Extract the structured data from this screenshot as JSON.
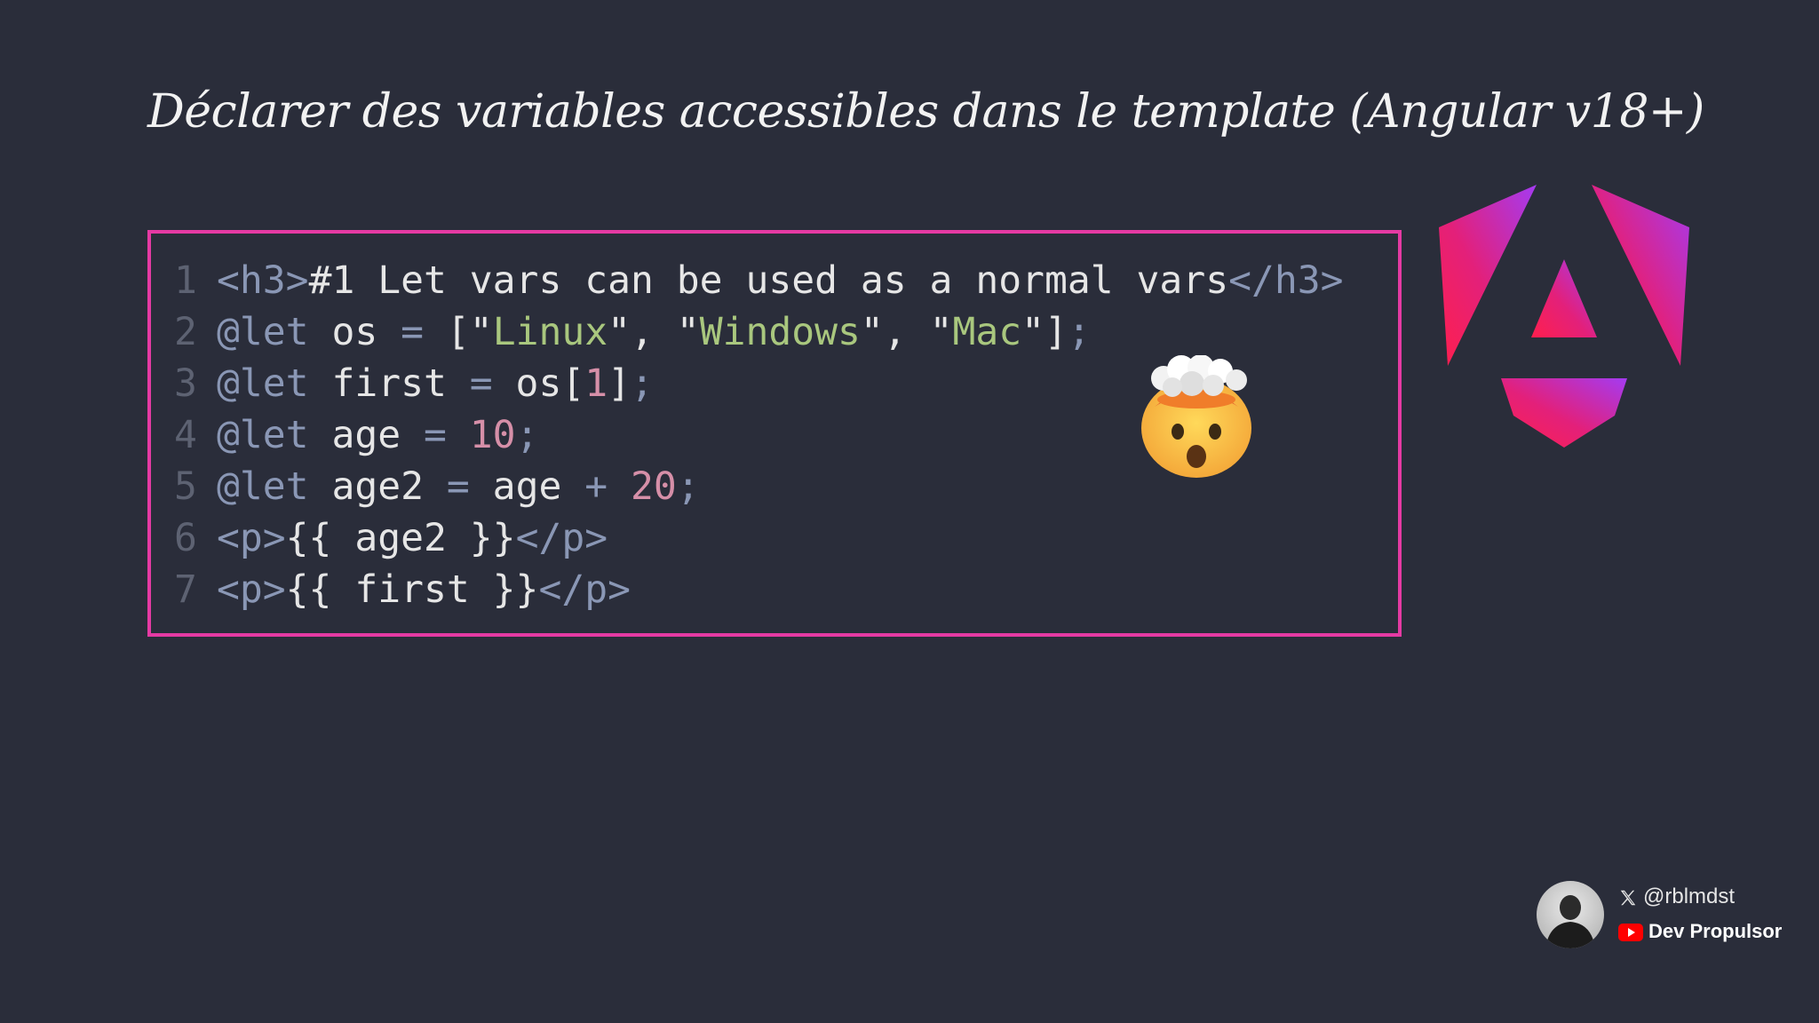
{
  "title": "Déclarer des variables accessibles dans le template (Angular v18+)",
  "code": {
    "lines": [
      {
        "n": "1",
        "tokens": [
          {
            "t": "<h3>",
            "c": "tag"
          },
          {
            "t": "#1 Let vars can be used as a normal vars",
            "c": "txt"
          },
          {
            "t": "</h3>",
            "c": "tag"
          }
        ]
      },
      {
        "n": "2",
        "tokens": [
          {
            "t": "@let",
            "c": "at"
          },
          {
            "t": " os ",
            "c": "txt"
          },
          {
            "t": "=",
            "c": "op"
          },
          {
            "t": " [\"",
            "c": "punc"
          },
          {
            "t": "Linux",
            "c": "str"
          },
          {
            "t": "\", \"",
            "c": "punc"
          },
          {
            "t": "Windows",
            "c": "str"
          },
          {
            "t": "\", \"",
            "c": "punc"
          },
          {
            "t": "Mac",
            "c": "str"
          },
          {
            "t": "\"]",
            "c": "punc"
          },
          {
            "t": ";",
            "c": "op"
          }
        ]
      },
      {
        "n": "3",
        "tokens": [
          {
            "t": "@let",
            "c": "at"
          },
          {
            "t": " first ",
            "c": "txt"
          },
          {
            "t": "=",
            "c": "op"
          },
          {
            "t": " os[",
            "c": "txt"
          },
          {
            "t": "1",
            "c": "num"
          },
          {
            "t": "]",
            "c": "txt"
          },
          {
            "t": ";",
            "c": "op"
          }
        ]
      },
      {
        "n": "4",
        "tokens": [
          {
            "t": "@let",
            "c": "at"
          },
          {
            "t": " age ",
            "c": "txt"
          },
          {
            "t": "=",
            "c": "op"
          },
          {
            "t": " ",
            "c": "txt"
          },
          {
            "t": "10",
            "c": "num"
          },
          {
            "t": ";",
            "c": "op"
          }
        ]
      },
      {
        "n": "5",
        "tokens": [
          {
            "t": "@let",
            "c": "at"
          },
          {
            "t": " age2 ",
            "c": "txt"
          },
          {
            "t": "=",
            "c": "op"
          },
          {
            "t": " age ",
            "c": "txt"
          },
          {
            "t": "+",
            "c": "op"
          },
          {
            "t": " ",
            "c": "txt"
          },
          {
            "t": "20",
            "c": "num"
          },
          {
            "t": ";",
            "c": "op"
          }
        ]
      },
      {
        "n": "6",
        "tokens": [
          {
            "t": "<p>",
            "c": "tag"
          },
          {
            "t": "{{ age2 }}",
            "c": "txt"
          },
          {
            "t": "</p>",
            "c": "tag"
          }
        ]
      },
      {
        "n": "7",
        "tokens": [
          {
            "t": "<p>",
            "c": "tag"
          },
          {
            "t": "{{ first }}",
            "c": "txt"
          },
          {
            "t": "</p>",
            "c": "tag"
          }
        ]
      }
    ]
  },
  "decorations": {
    "emoji_icon": "exploding-head-icon",
    "logo_icon": "angular-logo-icon"
  },
  "credits": {
    "handle": "@rblmdst",
    "channel": "Dev Propulsor"
  },
  "colors": {
    "background": "#2a2d3a",
    "frame": "#e53aa3",
    "string": "#a9c77e",
    "number": "#d68fa8",
    "keyword": "#8a97b5"
  }
}
